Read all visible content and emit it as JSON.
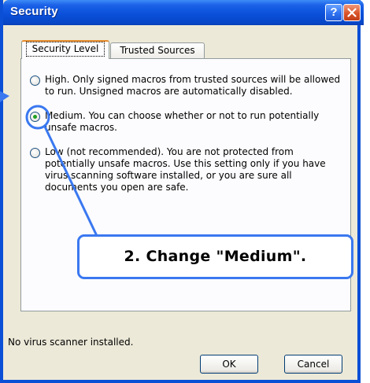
{
  "window": {
    "title": "Security"
  },
  "titlebar": {
    "help_label": "?"
  },
  "tabs": [
    {
      "label": "Security Level",
      "active": true
    },
    {
      "label": "Trusted Sources",
      "active": false
    }
  ],
  "options": [
    {
      "label": "High. Only signed macros from trusted sources will be allowed to run. Unsigned macros are automatically disabled.",
      "selected": false
    },
    {
      "label": "Medium. You can choose whether or not to run potentially unsafe macros.",
      "selected": true
    },
    {
      "label": "Low (not recommended). You are not protected from potentially unsafe macros. Use this setting only if you have virus scanning software installed, or you are sure all documents you open are safe.",
      "selected": false
    }
  ],
  "callout": {
    "text": "2. Change \"Medium\"."
  },
  "status": {
    "text": "No virus scanner installed."
  },
  "buttons": {
    "ok": "OK",
    "cancel": "Cancel"
  },
  "colors": {
    "titlebar": "#0A50DA",
    "callout_border": "#3A78F0",
    "radio_selected": "#21A121"
  }
}
